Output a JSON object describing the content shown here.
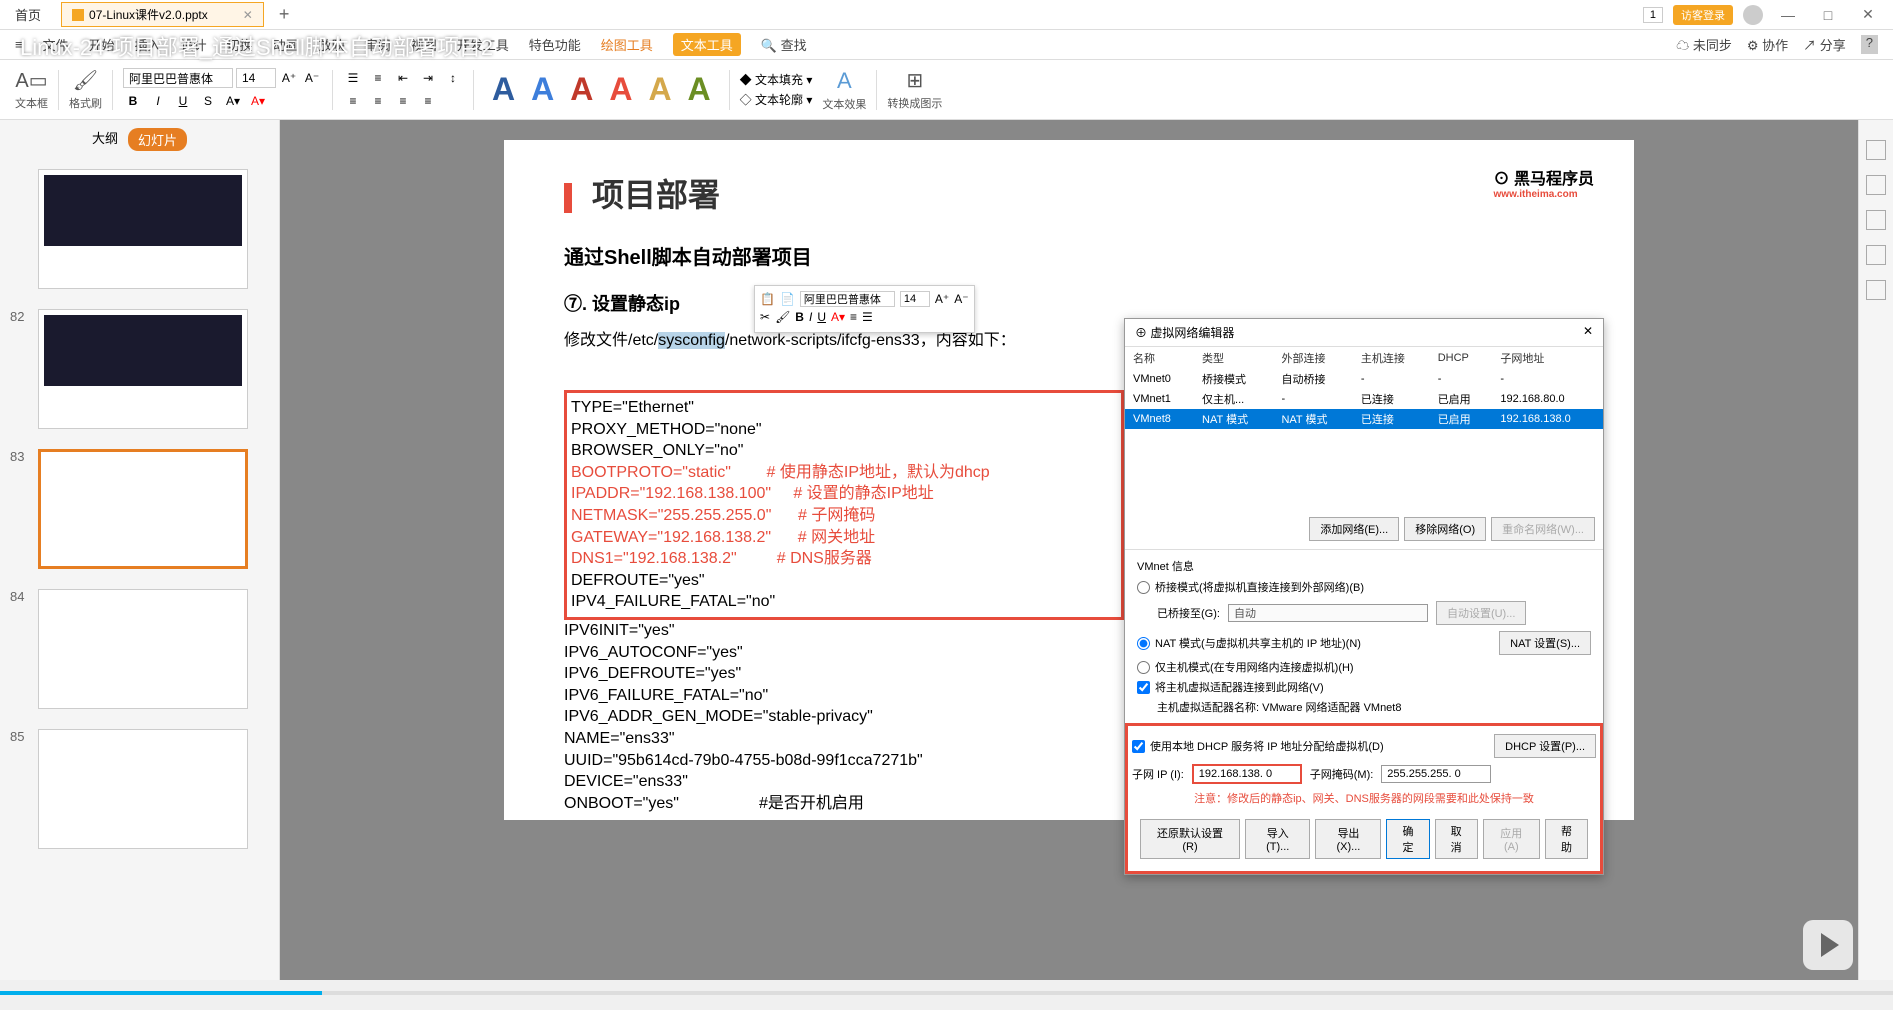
{
  "titlebar": {
    "home": "首页",
    "filename": "07-Linux课件v2.0.pptx",
    "badge_num": "1",
    "login": "访客登录"
  },
  "video_overlay": "Linux-24-项目部署_通过Shell脚本自动部署项目2",
  "menu": {
    "items": [
      "文件",
      "开始",
      "插入",
      "设计",
      "切换",
      "动画",
      "放映",
      "审阅",
      "视图",
      "开发工具",
      "特色功能"
    ],
    "drawing": "绘图工具",
    "texttool": "文本工具",
    "search": "查找",
    "unsync": "未同步",
    "collab": "协作",
    "share": "分享"
  },
  "ribbon": {
    "textbox": "文本框",
    "format": "格式刷",
    "font": "阿里巴巴普惠体",
    "size": "14",
    "textfill": "文本填充",
    "textoutline": "文本轮廓",
    "texteffect": "文本效果",
    "convert": "转换成图示"
  },
  "outline": {
    "tab1": "大纲",
    "tab2": "幻灯片",
    "nums": [
      "82",
      "83",
      "84",
      "85"
    ]
  },
  "slide": {
    "title": "项目部署",
    "subtitle": "通过Shell脚本自动部署项目",
    "logo": "黑马程序员",
    "logo_url": "www.itheima.com",
    "step": "⑦. 设置静态ip",
    "path_prefix": "修改文件/etc/",
    "path_hl": "sysconfig",
    "path_suffix": "/network-scripts/ifcfg-ens33，内容如下：",
    "code": {
      "l1": "TYPE=\"Ethernet\"",
      "l2": "PROXY_METHOD=\"none\"",
      "l3": "BROWSER_ONLY=\"no\"",
      "l4": "BOOTPROTO=\"static\"",
      "c4": "# 使用静态IP地址，默认为dhcp",
      "l5": "IPADDR=\"192.168.138.100\"",
      "c5": "# 设置的静态IP地址",
      "l6": "NETMASK=\"255.255.255.0\"",
      "c6": "# 子网掩码",
      "l7": "GATEWAY=\"192.168.138.2\"",
      "c7": "# 网关地址",
      "l8": "DNS1=\"192.168.138.2\"",
      "c8": "# DNS服务器",
      "l9": "DEFROUTE=\"yes\"",
      "l10": "IPV4_FAILURE_FATAL=\"no\"",
      "l11": "IPV6INIT=\"yes\"",
      "l12": "IPV6_AUTOCONF=\"yes\"",
      "l13": "IPV6_DEFROUTE=\"yes\"",
      "l14": "IPV6_FAILURE_FATAL=\"no\"",
      "l15": "IPV6_ADDR_GEN_MODE=\"stable-privacy\"",
      "l16": "NAME=\"ens33\"",
      "l17": "UUID=\"95b614cd-79b0-4755-b08d-99f1cca7271b\"",
      "l18": "DEVICE=\"ens33\"",
      "l19": "ONBOOT=\"yes\"",
      "c19": "#是否开机启用"
    }
  },
  "mini": {
    "font": "阿里巴巴普惠体",
    "size": "14"
  },
  "vmware": {
    "title": "虚拟网络编辑器",
    "headers": [
      "名称",
      "类型",
      "外部连接",
      "主机连接",
      "DHCP",
      "子网地址"
    ],
    "rows": [
      [
        "VMnet0",
        "桥接模式",
        "自动桥接",
        "-",
        "-",
        "-"
      ],
      [
        "VMnet1",
        "仅主机...",
        "-",
        "已连接",
        "已启用",
        "192.168.80.0"
      ],
      [
        "VMnet8",
        "NAT 模式",
        "NAT 模式",
        "已连接",
        "已启用",
        "192.168.138.0"
      ]
    ],
    "add_net": "添加网络(E)...",
    "remove_net": "移除网络(O)",
    "rename_net": "重命名网络(W)...",
    "info_label": "VMnet 信息",
    "bridge_label": "桥接模式(将虚拟机直接连接到外部网络)(B)",
    "bridge_to": "已桥接至(G):",
    "bridge_auto": "自动",
    "auto_set": "自动设置(U)...",
    "nat_label": "NAT 模式(与虚拟机共享主机的 IP 地址)(N)",
    "nat_set": "NAT 设置(S)...",
    "host_label": "仅主机模式(在专用网络内连接虚拟机)(H)",
    "connect_host": "将主机虚拟适配器连接到此网络(V)",
    "adapter_name": "主机虚拟适配器名称: VMware 网络适配器 VMnet8",
    "dhcp_label": "使用本地 DHCP 服务将 IP 地址分配给虚拟机(D)",
    "dhcp_set": "DHCP 设置(P)...",
    "subnet_ip_label": "子网 IP (I):",
    "subnet_ip": "192.168.138. 0",
    "subnet_mask_label": "子网掩码(M):",
    "subnet_mask": "255.255.255. 0",
    "warning": "注意：修改后的静态ip、网关、DNS服务器的网段需要和此处保持一致",
    "restore": "还原默认设置(R)",
    "import": "导入(T)...",
    "export": "导出(X)...",
    "ok": "确定",
    "cancel": "取消",
    "apply": "应用(A)",
    "help": "帮助"
  }
}
